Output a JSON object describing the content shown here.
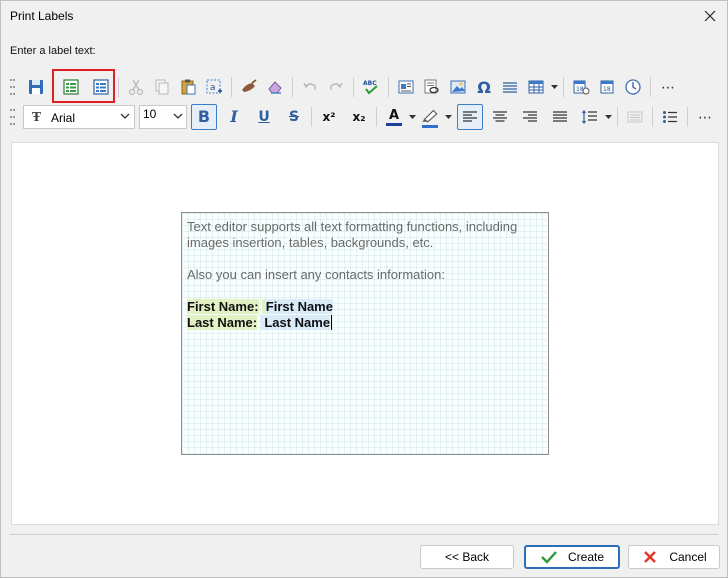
{
  "window": {
    "title": "Print Labels"
  },
  "prompt": "Enter a label text:",
  "toolbar": {
    "font": "Arial",
    "font_size": "10",
    "bold_letter": "B",
    "italic_letter": "I",
    "underline_letter": "U",
    "strike_letter": "S",
    "superscript_letter": "x²",
    "subscript_letter": "x₂",
    "font_color_letter": "A",
    "symbol_glyph": "Ω",
    "more_glyph": "⋯",
    "colors": {
      "font_color": "#1f3f99",
      "highlight_color": "#2f6fd0",
      "accent": "#3c7fc6",
      "callout": "#e02020"
    }
  },
  "editor": {
    "intro": "Text editor supports all text formatting functions, including images insertion, tables, backgrounds, etc.",
    "contacts_note": "Also you can insert any contacts information:",
    "first_name_label": "First Name:",
    "first_name_value": "First Name",
    "last_name_label": "Last Name:",
    "last_name_value": "Last Name"
  },
  "buttons": {
    "back": "<< Back",
    "create": "Create",
    "cancel": "Cancel"
  }
}
